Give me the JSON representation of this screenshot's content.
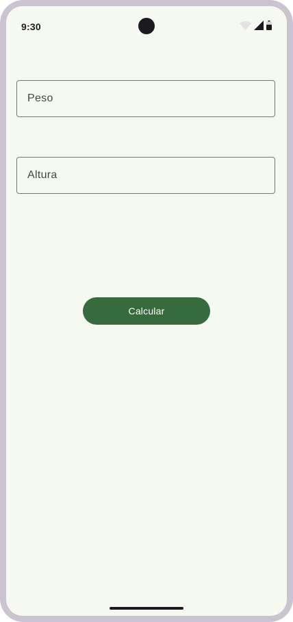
{
  "status_bar": {
    "time": "9:30",
    "icons": [
      "wifi-icon",
      "signal-icon",
      "battery-icon"
    ]
  },
  "form": {
    "peso_placeholder": "Peso",
    "altura_placeholder": "Altura",
    "calcular_label": "Calcular"
  },
  "colors": {
    "background": "#f6f9f0",
    "button": "#376a3c",
    "button_text": "#ffffff",
    "field_border": "#72796f",
    "frame": "#cbc4d0"
  }
}
